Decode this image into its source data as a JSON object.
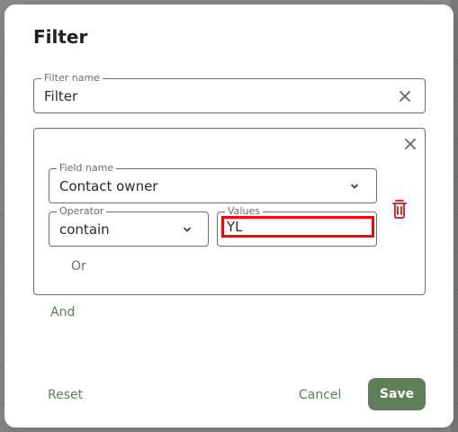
{
  "dialog": {
    "title": "Filter"
  },
  "filter_name": {
    "label": "Filter name",
    "value": "Filter",
    "clear_icon": "close-icon"
  },
  "group": {
    "remove_icon": "close-icon",
    "field_name": {
      "label": "Field name",
      "value": "Contact owner",
      "icon": "chevron-down-icon"
    },
    "operator": {
      "label": "Operator",
      "value": "contain",
      "icon": "chevron-down-icon"
    },
    "values": {
      "label": "Values",
      "value": "YL"
    },
    "delete_icon": "trash-icon",
    "or_label": "Or"
  },
  "and_label": "And",
  "footer": {
    "reset": "Reset",
    "cancel": "Cancel",
    "save": "Save"
  },
  "colors": {
    "accent": "#5f7f58",
    "danger": "#d32f2f",
    "highlight": "#ff0000"
  }
}
